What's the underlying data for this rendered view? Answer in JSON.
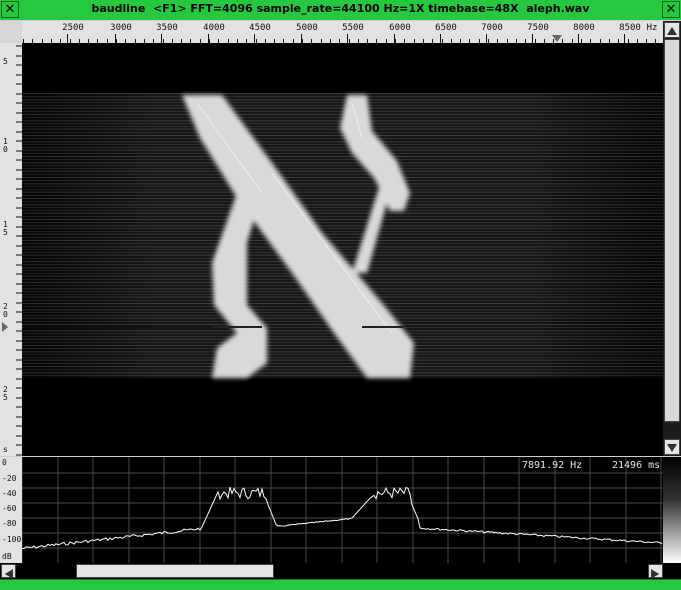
{
  "window": {
    "title": "baudline  <F1> FFT=4096 sample_rate=44100 Hz=1X timebase=48X  aleph.wav",
    "left_button_glyph": "✕",
    "right_button_glyph": "✕"
  },
  "freq_ruler": {
    "ticks": [
      "2500",
      "3000",
      "3500",
      "4000",
      "4500",
      "5000",
      "5500",
      "6000",
      "6500",
      "7000",
      "7500",
      "8000",
      "8500"
    ],
    "unit": "Hz"
  },
  "time_ruler": {
    "labels": [
      {
        "t": "5"
      },
      {
        "t": "1\n0"
      },
      {
        "t": "1\n5"
      },
      {
        "t": "2\n0"
      },
      {
        "t": "2\n5"
      },
      {
        "t": "s"
      }
    ]
  },
  "spectrum": {
    "db_labels": [
      "0",
      "-20",
      "-40",
      "-60",
      "-80",
      "-100",
      "dB"
    ],
    "readout_freq": "7891.92 Hz",
    "readout_time": "21496 ms"
  },
  "colors": {
    "titlebar": "#25c93f",
    "display_bg": "#000000",
    "trace": "#ffffff",
    "grid": "#4a4a4a"
  },
  "icons": {
    "close": "close-icon",
    "scroll_up": "arrow-up-icon",
    "scroll_down": "arrow-down-icon",
    "scroll_left": "arrow-left-icon",
    "scroll_right": "arrow-right-icon"
  }
}
